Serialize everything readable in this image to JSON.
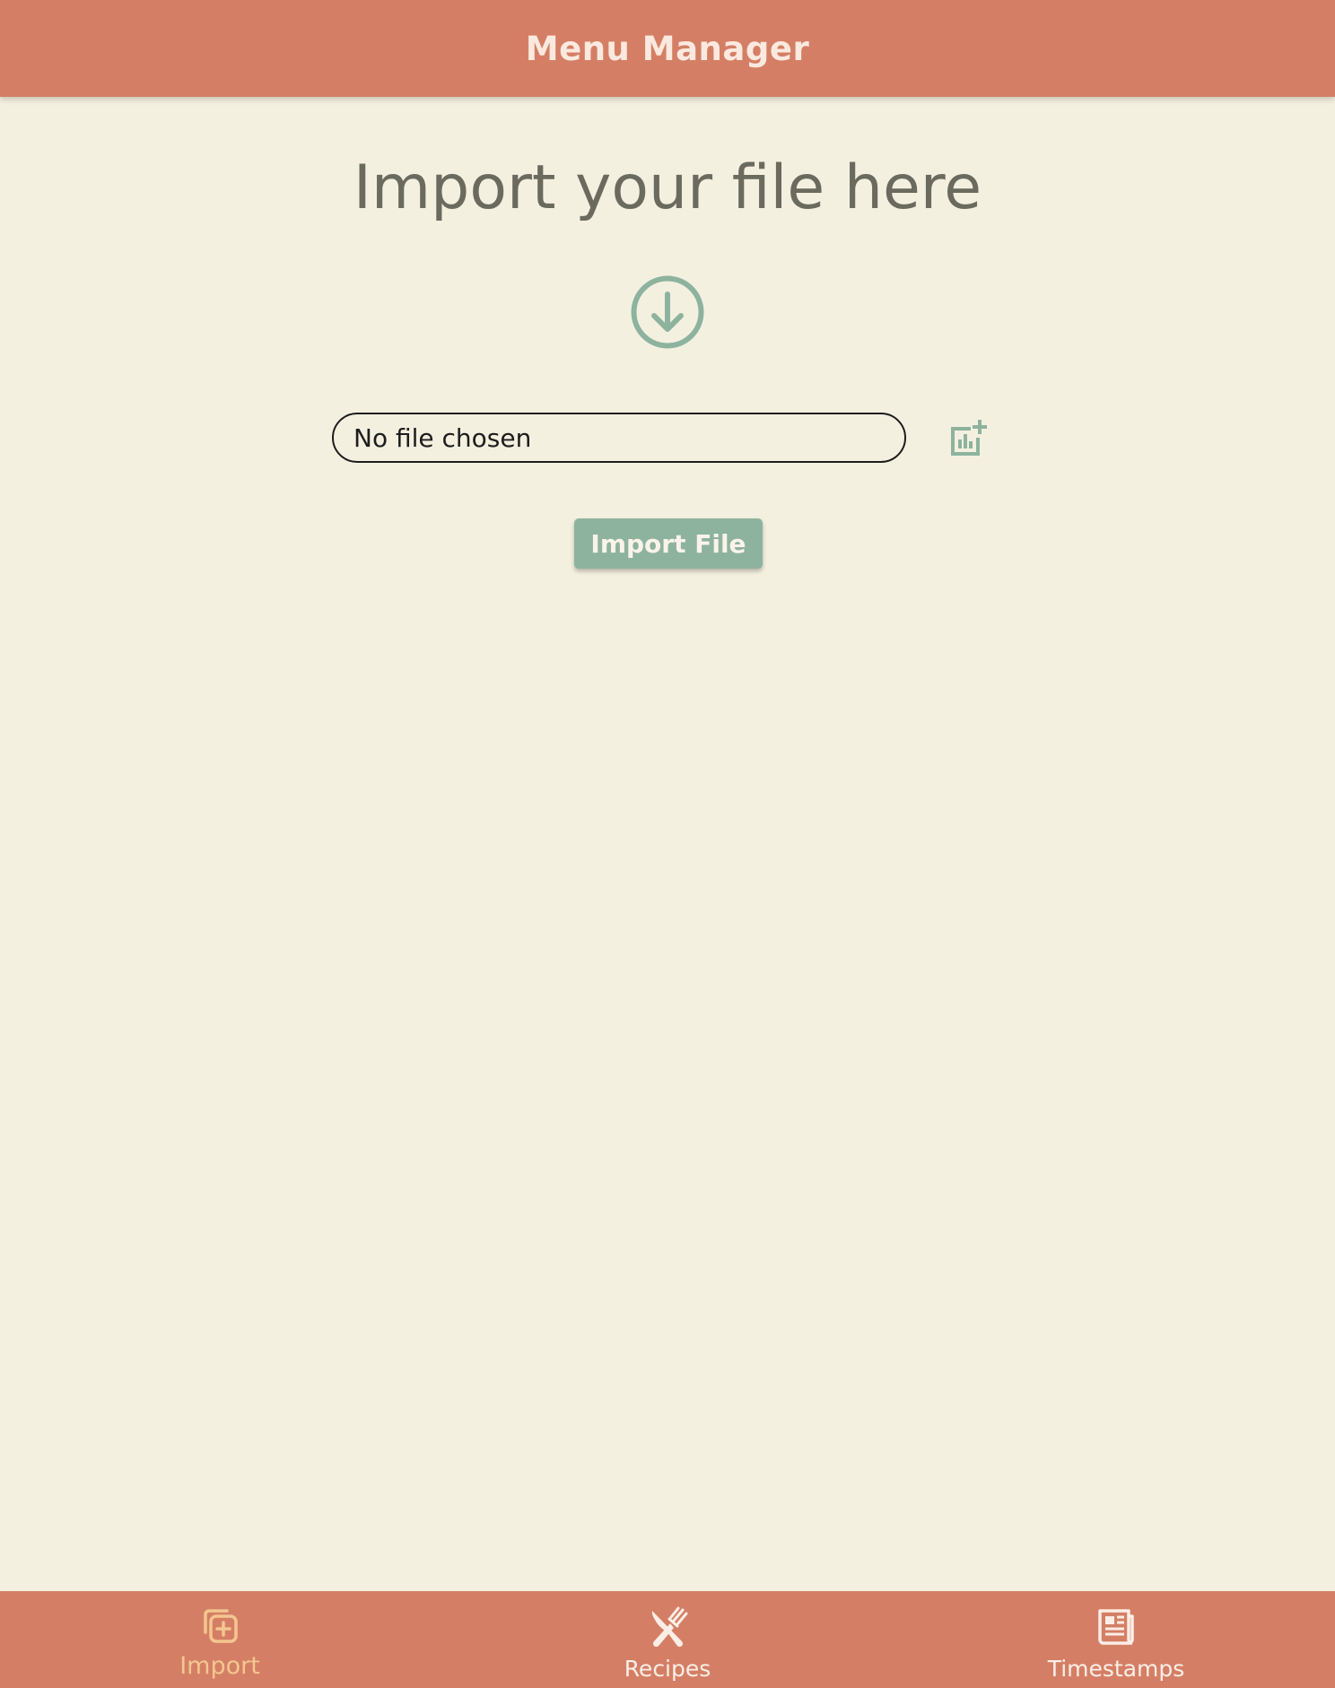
{
  "app": {
    "title": "Menu Manager"
  },
  "main": {
    "heading": "Import your file here",
    "file_input": {
      "status": "No file chosen"
    },
    "import_button_label": "Import File"
  },
  "bottom_nav": {
    "items": [
      {
        "label": "Import",
        "icon": "add-to-library-icon",
        "active": true
      },
      {
        "label": "Recipes",
        "icon": "fork-knife-icon",
        "active": false
      },
      {
        "label": "Timestamps",
        "icon": "newspaper-icon",
        "active": false
      }
    ]
  },
  "colors": {
    "header_background": "#d47f65",
    "page_background": "#f4f0e0",
    "accent_green": "#8db39e",
    "nav_active": "#f4c690",
    "nav_inactive": "#fbeee6",
    "heading_text": "#6b6a5e"
  }
}
